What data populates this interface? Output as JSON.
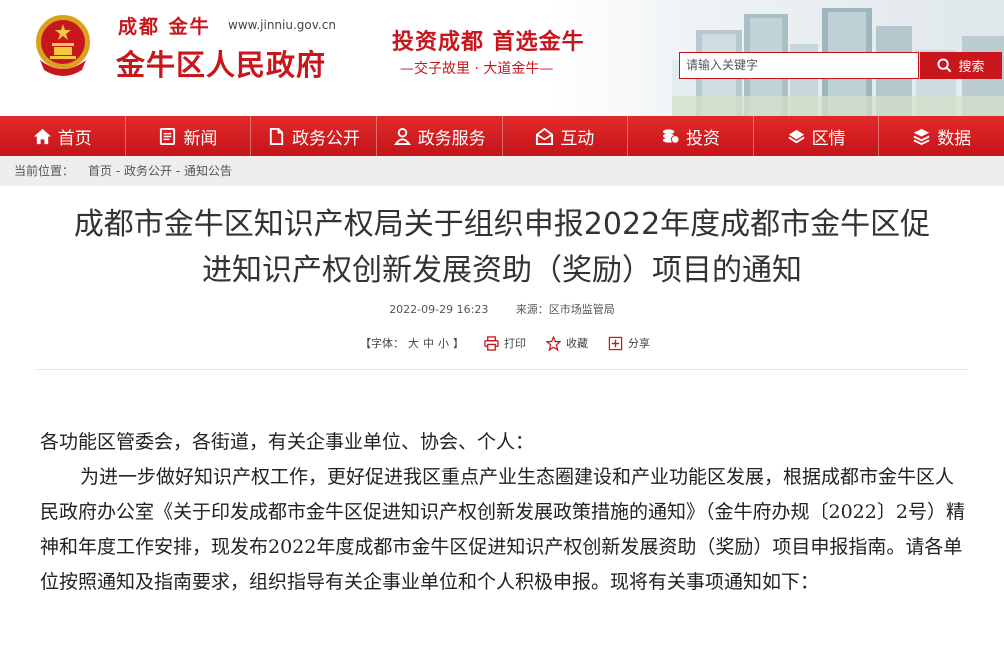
{
  "header": {
    "site_short": "成都 金牛",
    "site_url": "www.jinniu.gov.cn",
    "site_name": "金牛区人民政府",
    "slogan_main": "投资成都  首选金牛",
    "slogan_sub": "—交子故里 · 大道金牛—",
    "search_placeholder": "请输入关键字",
    "search_button": "搜索"
  },
  "nav": {
    "items": [
      {
        "label": "首页",
        "icon": "home-icon"
      },
      {
        "label": "新闻",
        "icon": "news-icon"
      },
      {
        "label": "政务公开",
        "icon": "document-icon"
      },
      {
        "label": "政务服务",
        "icon": "service-icon"
      },
      {
        "label": "互动",
        "icon": "mail-icon"
      },
      {
        "label": "投资",
        "icon": "coins-icon"
      },
      {
        "label": "区情",
        "icon": "layers-icon"
      },
      {
        "label": "数据",
        "icon": "stack-icon"
      }
    ]
  },
  "breadcrumb": {
    "label": "当前位置：",
    "items": [
      "首页",
      "政务公开",
      "通知公告"
    ],
    "separator": " - "
  },
  "article": {
    "title_line1": "成都市金牛区知识产权局关于组织申报2022年度成都市金牛区促",
    "title_line2": "进知识产权创新发展资助（奖励）项目的通知",
    "date": "2022-09-29 16:23",
    "source": "来源：区市场监管局",
    "font_label": "【字体：",
    "font_sizes": [
      "大",
      "中",
      "小"
    ],
    "font_end": "】",
    "print": "打印",
    "favorite": "收藏",
    "share": "分享",
    "greeting": "各功能区管委会，各街道，有关企事业单位、协会、个人：",
    "paragraph": "为进一步做好知识产权工作，更好促进我区重点产业生态圈建设和产业功能区发展，根据成都市金牛区人民政府办公室《关于印发成都市金牛区促进知识产权创新发展政策措施的通知》（金牛府办规〔2022〕2号）精神和年度工作安排，现发布2022年度成都市金牛区促进知识产权创新发展资助（奖励）项目申报指南。请各单位按照通知及指南要求，组织指导有关企事业单位和个人积极申报。现将有关事项通知如下："
  },
  "colors": {
    "brand_red": "#c8161d",
    "nav_red": "#d81e22",
    "crumb_bg": "#eeeeee"
  }
}
